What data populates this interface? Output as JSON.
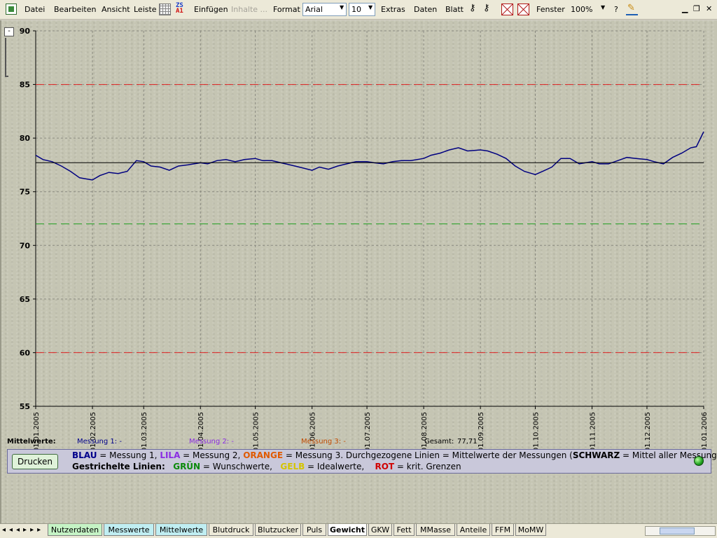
{
  "menu": {
    "items": [
      "Datei",
      "Bearbeiten",
      "Ansicht",
      "Leiste",
      "Einfügen",
      "Inhalte ...",
      "Format",
      "Extras",
      "Daten",
      "Blatt",
      "Fenster",
      "?"
    ],
    "font_name": "Arial",
    "font_size": "10",
    "zoom": "100%",
    "zs_icon_text": [
      "ZS",
      "A1"
    ]
  },
  "chart_data": {
    "type": "line",
    "title": "",
    "xlabel": "",
    "ylabel": "",
    "ylim": [
      55,
      90
    ],
    "yticks": [
      "55",
      "60",
      "65",
      "70",
      "75",
      "80",
      "85",
      "90"
    ],
    "xticks": [
      "01.01.2005",
      "01.02.2005",
      "01.03.2005",
      "01.04.2005",
      "01.05.2005",
      "01.06.2005",
      "01.07.2005",
      "01.08.2005",
      "01.09.2005",
      "01.10.2005",
      "01.11.2005",
      "01.12.2005",
      "01.01.2006"
    ],
    "grid": true,
    "series": [
      {
        "color": "#000080",
        "points": [
          [
            "01.01.2005",
            78.4
          ],
          [
            "05.01.2005",
            78.0
          ],
          [
            "10.01.2005",
            77.8
          ],
          [
            "15.01.2005",
            77.4
          ],
          [
            "20.01.2005",
            76.9
          ],
          [
            "25.01.2005",
            76.3
          ],
          [
            "01.02.2005",
            76.1
          ],
          [
            "05.02.2005",
            76.5
          ],
          [
            "10.02.2005",
            76.8
          ],
          [
            "15.02.2005",
            76.7
          ],
          [
            "20.02.2005",
            76.9
          ],
          [
            "25.02.2005",
            77.9
          ],
          [
            "01.03.2005",
            77.8
          ],
          [
            "05.03.2005",
            77.4
          ],
          [
            "10.03.2005",
            77.3
          ],
          [
            "15.03.2005",
            77.0
          ],
          [
            "20.03.2005",
            77.4
          ],
          [
            "25.03.2005",
            77.5
          ],
          [
            "01.04.2005",
            77.7
          ],
          [
            "05.04.2005",
            77.6
          ],
          [
            "10.04.2005",
            77.9
          ],
          [
            "15.04.2005",
            78.0
          ],
          [
            "20.04.2005",
            77.8
          ],
          [
            "25.04.2005",
            78.0
          ],
          [
            "01.05.2005",
            78.1
          ],
          [
            "05.05.2005",
            77.9
          ],
          [
            "10.05.2005",
            77.9
          ],
          [
            "15.05.2005",
            77.7
          ],
          [
            "20.05.2005",
            77.5
          ],
          [
            "25.05.2005",
            77.3
          ],
          [
            "01.06.2005",
            77.0
          ],
          [
            "05.06.2005",
            77.3
          ],
          [
            "10.06.2005",
            77.1
          ],
          [
            "15.06.2005",
            77.4
          ],
          [
            "20.06.2005",
            77.6
          ],
          [
            "25.06.2005",
            77.8
          ],
          [
            "01.07.2005",
            77.8
          ],
          [
            "05.07.2005",
            77.7
          ],
          [
            "10.07.2005",
            77.6
          ],
          [
            "15.07.2005",
            77.8
          ],
          [
            "20.07.2005",
            77.9
          ],
          [
            "25.07.2005",
            77.9
          ],
          [
            "01.08.2005",
            78.1
          ],
          [
            "05.08.2005",
            78.4
          ],
          [
            "10.08.2005",
            78.6
          ],
          [
            "15.08.2005",
            78.9
          ],
          [
            "20.08.2005",
            79.1
          ],
          [
            "25.08.2005",
            78.8
          ],
          [
            "01.09.2005",
            78.9
          ],
          [
            "05.09.2005",
            78.8
          ],
          [
            "10.09.2005",
            78.5
          ],
          [
            "15.09.2005",
            78.1
          ],
          [
            "20.09.2005",
            77.4
          ],
          [
            "25.09.2005",
            76.9
          ],
          [
            "01.10.2005",
            76.6
          ],
          [
            "05.10.2005",
            76.9
          ],
          [
            "10.10.2005",
            77.3
          ],
          [
            "15.10.2005",
            78.1
          ],
          [
            "20.10.2005",
            78.1
          ],
          [
            "25.10.2005",
            77.6
          ],
          [
            "01.11.2005",
            77.8
          ],
          [
            "05.11.2005",
            77.6
          ],
          [
            "10.11.2005",
            77.6
          ],
          [
            "15.11.2005",
            77.9
          ],
          [
            "20.11.2005",
            78.2
          ],
          [
            "25.11.2005",
            78.1
          ],
          [
            "01.12.2005",
            78.0
          ],
          [
            "05.12.2005",
            77.8
          ],
          [
            "10.12.2005",
            77.6
          ],
          [
            "15.12.2005",
            78.2
          ],
          [
            "20.12.2005",
            78.6
          ],
          [
            "25.12.2005",
            79.1
          ],
          [
            "28.12.2005",
            79.2
          ],
          [
            "01.01.2006",
            80.6
          ]
        ]
      },
      {
        "color": "#000000",
        "points": [
          [
            "01.01.2005",
            77.71
          ],
          [
            "01.01.2006",
            77.71
          ]
        ]
      }
    ],
    "reference_lines": [
      {
        "y": 85,
        "color": "#e02020",
        "style": "dashed"
      },
      {
        "y": 72,
        "color": "#20a020",
        "style": "dashed"
      },
      {
        "y": 60,
        "color": "#e02020",
        "style": "dashed"
      }
    ]
  },
  "mittelwerte": {
    "label": "Mittelwerte:",
    "m1": "Messung 1:  -",
    "m2": "Messung 2:  -",
    "m3": "Messung 3:  -",
    "gesamt_label": "Gesamt:",
    "gesamt_value": "77,71"
  },
  "legend": {
    "print_button": "Drucken",
    "blau": "BLAU",
    "messung1": " = Messung 1, ",
    "lila": "LILA",
    "messung2": " = Messung 2, ",
    "orange": "ORANGE",
    "messung3": " = Messung 3. Durchgezogene Linien = Mittelwerte der Messungen (",
    "schwarz": "SCHWARZ",
    "mittel": " = Mittel aller Messungen)",
    "gestrichelt": "Gestrichelte Linien:",
    "gruen": "GRÜN",
    "wunsch": " = Wunschwerte, ",
    "gelb": "GELB",
    "ideal": " = Idealwerte,",
    "rot": "ROT",
    "krit": " = krit. Grenzen",
    "colors": {
      "blau": "#00008b",
      "lila": "#8a2be2",
      "orange": "#e05a00",
      "gruen": "#0a8a0a",
      "gelb": "#d4c400",
      "rot": "#d00000"
    }
  },
  "tabs": [
    "Nutzerdaten",
    "Messwerte",
    "Mittelwerte",
    "Blutdruck",
    "Blutzucker",
    "Puls",
    "Gewicht",
    "GKW",
    "Fett",
    "MMasse",
    "Anteile",
    "FFM",
    "MoMW"
  ],
  "active_tab": "Gewicht"
}
